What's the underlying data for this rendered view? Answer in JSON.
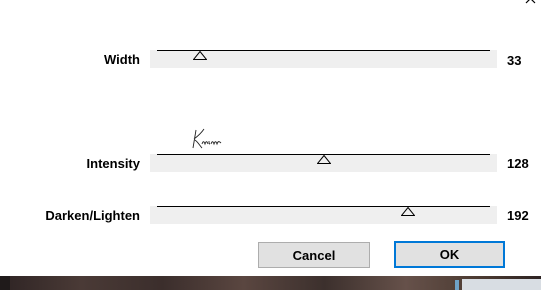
{
  "dialog": {
    "close_icon": "close-icon"
  },
  "sliders": [
    {
      "label": "Width",
      "value": "33",
      "min": 0,
      "max": 255,
      "position": 33
    },
    {
      "label": "Intensity",
      "value": "128",
      "min": 0,
      "max": 255,
      "position": 128
    },
    {
      "label": "Darken/Lighten",
      "value": "192",
      "min": 0,
      "max": 255,
      "position": 192
    }
  ],
  "signature": {
    "icon": "handwritten-signature"
  },
  "buttons": {
    "cancel_label": "Cancel",
    "ok_label": "OK"
  },
  "colors": {
    "track": "#efefef",
    "button_face": "#e1e1e1",
    "default_button_border": "#0078d7"
  }
}
